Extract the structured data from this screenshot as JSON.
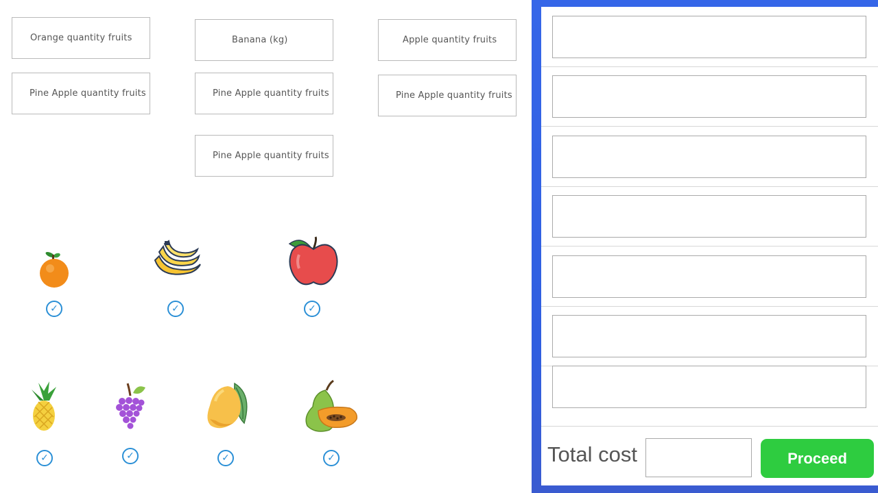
{
  "quantity_labels": {
    "orange": "Orange quantity fruits",
    "banana": "Banana (kg)",
    "apple": "Apple quantity fruits",
    "pineapple_1": "Pine Apple quantity fruits",
    "pineapple_2": "Pine Apple quantity fruits",
    "pineapple_3": "Pine Apple quantity fruits",
    "pineapple_4": "Pine Apple quantity fruits"
  },
  "fruits": [
    "orange-icon",
    "banana-icon",
    "apple-icon",
    "pineapple-icon",
    "grapes-icon",
    "mango-icon",
    "papaya-icon"
  ],
  "order_panel": {
    "rows": [
      "",
      "",
      "",
      "",
      "",
      "",
      ""
    ],
    "total_label": "Total cost",
    "total_value": "",
    "proceed_label": "Proceed"
  },
  "colors": {
    "panel_blue": "#3566e8",
    "proceed_green": "#2ecc40",
    "check_blue": "#2a8fd6"
  }
}
